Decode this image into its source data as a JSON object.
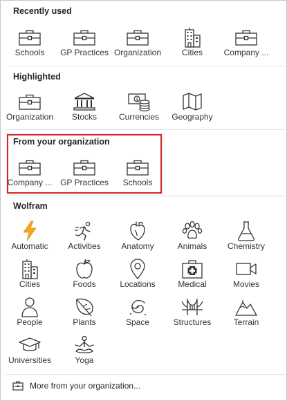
{
  "sections": {
    "recent": {
      "title": "Recently used",
      "items": [
        {
          "label": "Schools",
          "icon": "briefcase-icon"
        },
        {
          "label": "GP Practices",
          "icon": "briefcase-icon"
        },
        {
          "label": "Organization",
          "icon": "briefcase-icon"
        },
        {
          "label": "Cities",
          "icon": "city-building-icon"
        },
        {
          "label": "Company ...",
          "icon": "briefcase-icon"
        }
      ]
    },
    "highlighted": {
      "title": "Highlighted",
      "items": [
        {
          "label": "Organization",
          "icon": "briefcase-icon"
        },
        {
          "label": "Stocks",
          "icon": "bank-icon"
        },
        {
          "label": "Currencies",
          "icon": "currency-icon"
        },
        {
          "label": "Geography",
          "icon": "map-icon"
        }
      ]
    },
    "organization": {
      "title": "From your organization",
      "items": [
        {
          "label": "Company ...",
          "icon": "briefcase-icon"
        },
        {
          "label": "GP Practices",
          "icon": "briefcase-icon"
        },
        {
          "label": "Schools",
          "icon": "briefcase-icon"
        }
      ]
    },
    "wolfram": {
      "title": "Wolfram",
      "items": [
        {
          "label": "Automatic",
          "icon": "lightning-icon"
        },
        {
          "label": "Activities",
          "icon": "runner-icon"
        },
        {
          "label": "Anatomy",
          "icon": "heart-icon"
        },
        {
          "label": "Animals",
          "icon": "paw-icon"
        },
        {
          "label": "Chemistry",
          "icon": "flask-icon"
        },
        {
          "label": "Cities",
          "icon": "city-building-icon"
        },
        {
          "label": "Foods",
          "icon": "apple-icon"
        },
        {
          "label": "Locations",
          "icon": "map-pin-icon"
        },
        {
          "label": "Medical",
          "icon": "medical-kit-icon"
        },
        {
          "label": "Movies",
          "icon": "video-camera-icon"
        },
        {
          "label": "People",
          "icon": "person-icon"
        },
        {
          "label": "Plants",
          "icon": "leaf-icon"
        },
        {
          "label": "Space",
          "icon": "galaxy-icon"
        },
        {
          "label": "Structures",
          "icon": "bridge-icon"
        },
        {
          "label": "Terrain",
          "icon": "mountain-icon"
        },
        {
          "label": "Universities",
          "icon": "graduation-cap-icon"
        },
        {
          "label": "Yoga",
          "icon": "yoga-icon"
        }
      ]
    }
  },
  "footer": {
    "label": "More from your organization...",
    "icon": "briefcase-small-icon"
  },
  "colors": {
    "highlight_border": "#d42b2b",
    "lightning": "#f5a623",
    "icon_stroke": "#333333"
  }
}
